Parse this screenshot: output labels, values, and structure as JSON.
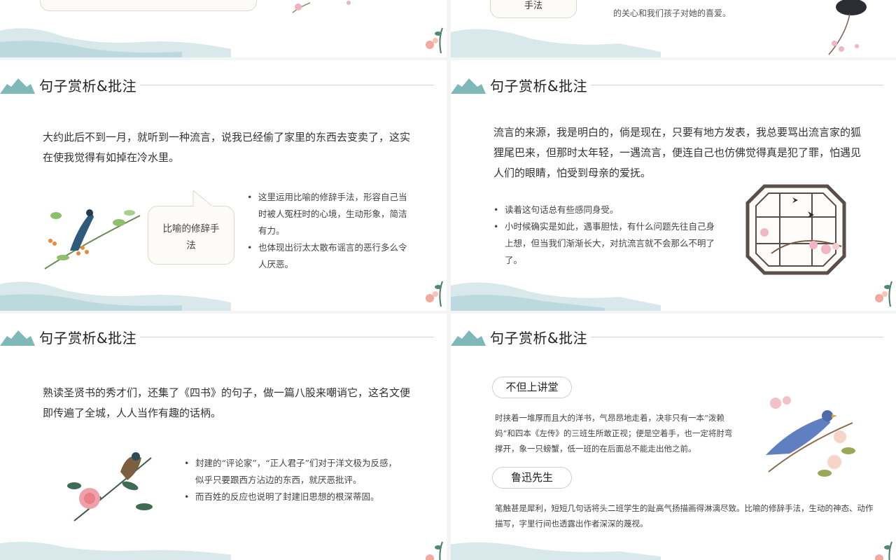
{
  "slides": {
    "top_right_fragment": {
      "button_label": "手法",
      "line1": "的关心和我们孩子对她的喜爱。"
    },
    "slide1": {
      "title": "句子赏析&批注",
      "paragraph": "大约此后不到一月，就听到一种流言，说我已经偷了家里的东西去变卖了，这实在使我觉得有如掉在冷水里。",
      "bubble": "比喻的修辞手法",
      "bullets": [
        "这里运用比喻的修辞手法，形容自己当时被人冤枉时的心境，生动形象，简洁有力。",
        "也体现出衍太太散布谣言的恶行多么令人厌恶。"
      ]
    },
    "slide2": {
      "title": "句子赏析&批注",
      "paragraph": "流言的来源，我是明白的，倘是现在，只要有地方发表，我总要骂出流言家的狐狸尾巴来，但那时太年轻，一遇流言，便连自己也仿佛觉得真是犯了罪，怕遇见人们的眼睛，怕受到母亲的爱抚。",
      "bullets": [
        "读着这句话总有些感同身受。",
        "小时候确实是如此，遇事胆怯，有什么问题先往自己身上想，但当我们渐渐长大，对抗流言就不会那么不明了了。"
      ]
    },
    "slide3": {
      "title": "句子赏析&批注",
      "paragraph": "熟读圣贤书的秀才们，还集了《四书》的句子，做一篇八股来嘲诮它，这名文便即传遍了全城，人人当作有趣的话柄。",
      "bullets": [
        "封建的“评论家”，“正人君子”们对于洋文极为反感，似乎只要跟西方沾边的东西，就厌恶批评。",
        "而百姓的反应也说明了封建旧思想的根深蒂固。"
      ]
    },
    "slide4": {
      "title": "句子赏析&批注",
      "pill1": "不但上讲堂",
      "text1": "时挟着一堆厚而且大的洋书，气昂昂地走着，决非只有一本“泼赖妈”和四本《左传》的三班生所敢正视；便是空着手，也一定将肘弯撑开，象一只螃蟹，低一班的在后面总不能走出他之前。",
      "pill2": "鲁迅先生",
      "text2": "笔触甚是犀利，短短几句话将头二班学生的趾高气扬描画得淋漓尽致。比喻的修辞手法，生动的神态、动作描写，字里行间也透露出作者深深的蔑视。"
    }
  },
  "colors": {
    "accent_teal": "#7fb8b8",
    "bubble_bg": "#fcfbf7",
    "line": "#cfd4d8"
  }
}
